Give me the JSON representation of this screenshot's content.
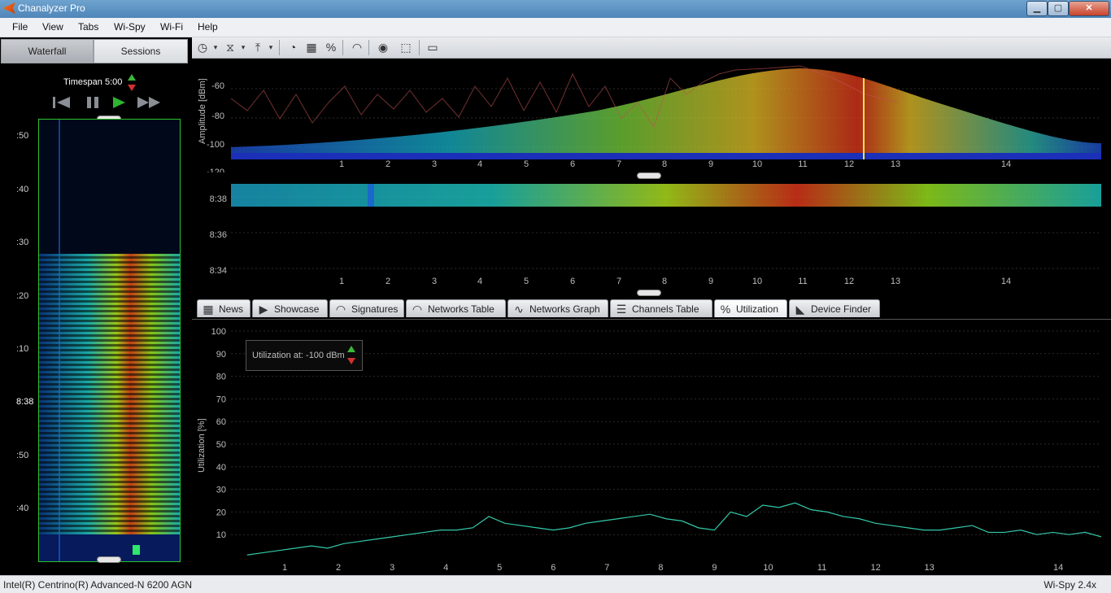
{
  "window": {
    "title": "Chanalyzer Pro",
    "controls": {
      "minimize": "▁",
      "maximize": "▢",
      "close": "✕"
    }
  },
  "menu": [
    "File",
    "View",
    "Tabs",
    "Wi-Spy",
    "Wi-Fi",
    "Help"
  ],
  "left_panel": {
    "tabs": [
      "Waterfall",
      "Sessions"
    ],
    "timespan": "Timespan 5:00",
    "time_labels": [
      ":50",
      ":40",
      ":30",
      ":20",
      ":10",
      "8:38",
      ":50",
      ":40"
    ]
  },
  "toolbar": {
    "icons": [
      "clock-icon",
      "filter-icon",
      "upload-icon",
      "gauge-icon",
      "waterfall-icon",
      "percent-icon",
      "wifi-icon",
      "broadcast-icon",
      "selection-icon",
      "window-icon"
    ]
  },
  "spectrum": {
    "ylabel": "Amplitude [dBm]",
    "y_ticks": [
      "-60",
      "-80",
      "-100",
      "-120"
    ],
    "x_ticks": [
      "1",
      "2",
      "3",
      "4",
      "5",
      "6",
      "7",
      "8",
      "9",
      "10",
      "11",
      "12",
      "13",
      "14"
    ]
  },
  "waterfall_mini": {
    "y_ticks": [
      "8:38",
      "8:36",
      "8:34"
    ],
    "x_ticks": [
      "1",
      "2",
      "3",
      "4",
      "5",
      "6",
      "7",
      "8",
      "9",
      "10",
      "11",
      "12",
      "13",
      "14"
    ]
  },
  "content_tabs": [
    {
      "label": "News",
      "icon": "news-icon"
    },
    {
      "label": "Showcase",
      "icon": "play-icon"
    },
    {
      "label": "Signatures",
      "icon": "signature-icon"
    },
    {
      "label": "Networks Table",
      "icon": "wifi-icon"
    },
    {
      "label": "Networks Graph",
      "icon": "graph-icon"
    },
    {
      "label": "Channels Table",
      "icon": "channels-icon"
    },
    {
      "label": "Utilization",
      "icon": "percent-icon",
      "active": true
    },
    {
      "label": "Device Finder",
      "icon": "device-finder-icon"
    }
  ],
  "utilization": {
    "control_label": "Utilization at:  -100 dBm"
  },
  "status": {
    "adapter": "Intel(R) Centrino(R) Advanced-N 6200 AGN",
    "device": "Wi-Spy 2.4x"
  },
  "chart_data": {
    "type": "line",
    "ylabel": "Utilization [%]",
    "ylim": [
      0,
      100
    ],
    "y_ticks": [
      10,
      20,
      30,
      40,
      50,
      60,
      70,
      80,
      90,
      100
    ],
    "x_ticks": [
      "1",
      "2",
      "3",
      "4",
      "5",
      "6",
      "7",
      "8",
      "9",
      "10",
      "11",
      "12",
      "13",
      "14"
    ],
    "grid": true,
    "series": [
      {
        "x": [
          0.3,
          0.6,
          0.9,
          1.2,
          1.5,
          1.8,
          2.1,
          2.4,
          2.7,
          3.0,
          3.3,
          3.6,
          3.9,
          4.2,
          4.5,
          4.8,
          5.1,
          5.4,
          5.7,
          6.0,
          6.3,
          6.6,
          6.9,
          7.2,
          7.5,
          7.8,
          8.1,
          8.4,
          8.7,
          9.0,
          9.3,
          9.6,
          9.9,
          10.2,
          10.5,
          10.8,
          11.1,
          11.4,
          11.7,
          12.0,
          12.3,
          12.6,
          12.9,
          13.2,
          13.5,
          13.8,
          14.1,
          14.4,
          14.7,
          15.0,
          15.3,
          15.6,
          15.9,
          16.2
        ],
        "values": [
          1,
          2,
          3,
          4,
          5,
          4,
          6,
          7,
          8,
          9,
          10,
          11,
          12,
          12,
          13,
          18,
          15,
          14,
          13,
          12,
          13,
          15,
          16,
          17,
          18,
          19,
          17,
          16,
          13,
          12,
          20,
          18,
          23,
          22,
          24,
          21,
          20,
          18,
          17,
          15,
          14,
          13,
          12,
          12,
          13,
          14,
          11,
          11,
          12,
          10,
          11,
          10,
          11,
          9
        ]
      }
    ]
  }
}
